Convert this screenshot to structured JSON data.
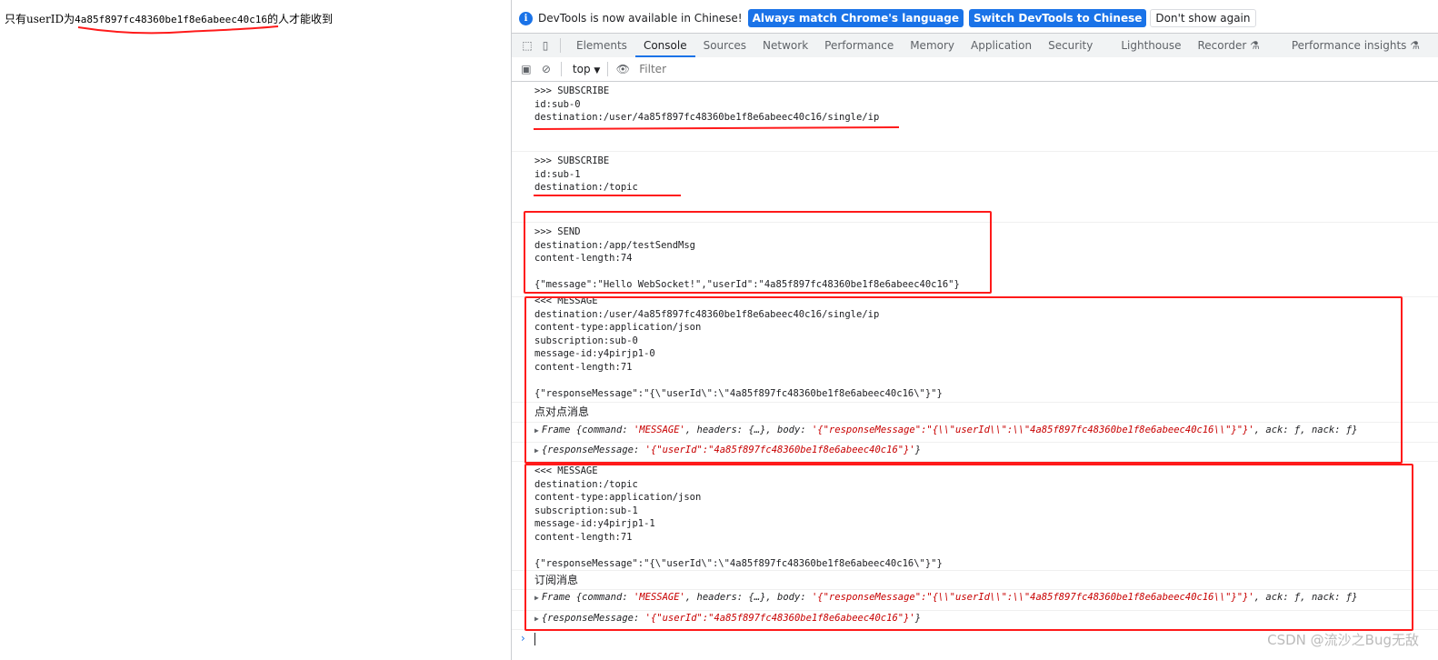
{
  "page": {
    "text_before": "只有userID为",
    "user_id": "4a85f897fc48360be1f8e6abeec40c16",
    "text_after": "的人才能收到"
  },
  "devtools": {
    "infobar": {
      "message": "DevTools is now available in Chinese!",
      "match_language": "Always match Chrome's language",
      "switch_chinese": "Switch DevTools to Chinese",
      "dont_show": "Don't show again"
    },
    "tabs": [
      "Elements",
      "Console",
      "Sources",
      "Network",
      "Performance",
      "Memory",
      "Application",
      "Security",
      "Lighthouse",
      "Recorder ⚗",
      "Performance insights ⚗"
    ],
    "active_tab": "Console",
    "toolbar": {
      "context": "top",
      "filter_placeholder": "Filter"
    }
  },
  "console": {
    "sub0": ">>> SUBSCRIBE\nid:sub-0\ndestination:/user/4a85f897fc48360be1f8e6abeec40c16/single/ip",
    "sub1": ">>> SUBSCRIBE\nid:sub-1\ndestination:/topic",
    "send": ">>> SEND\ndestination:/app/testSendMsg\ncontent-length:74\n\n{\"message\":\"Hello WebSocket!\",\"userId\":\"4a85f897fc48360be1f8e6abeec40c16\"}",
    "msg1": "<<< MESSAGE\ndestination:/user/4a85f897fc48360be1f8e6abeec40c16/single/ip\ncontent-type:application/json\nsubscription:sub-0\nmessage-id:y4pirjp1-0\ncontent-length:71\n\n{\"responseMessage\":\"{\\\"userId\\\":\\\"4a85f897fc48360be1f8e6abeec40c16\\\"}\"}",
    "label1": "点对点消息",
    "msg2": "<<< MESSAGE\ndestination:/topic\ncontent-type:application/json\nsubscription:sub-1\nmessage-id:y4pirjp1-1\ncontent-length:71\n\n{\"responseMessage\":\"{\\\"userId\\\":\\\"4a85f897fc48360be1f8e6abeec40c16\\\"}\"}",
    "label2": "订阅消息",
    "frame_prefix": "Frame {command: ",
    "frame_cmd": "'MESSAGE'",
    "frame_mid": ", headers: {…}, body: ",
    "frame_body": "'{\"responseMessage\":\"{\\\\\"userId\\\\\":\\\\\"4a85f897fc48360be1f8e6abeec40c16\\\\\"}\"}'",
    "frame_suffix": ", ack: ƒ, nack: ƒ}",
    "resp_prefix": "{responseMessage: ",
    "resp_body": "'{\"userId\":\"4a85f897fc48360be1f8e6abeec40c16\"}'",
    "resp_suffix": "}"
  },
  "watermark": "CSDN @流沙之Bug无敌",
  "colors": {
    "annotation": "#ff1a1a",
    "accent": "#1a73e8",
    "string": "#c80000"
  }
}
